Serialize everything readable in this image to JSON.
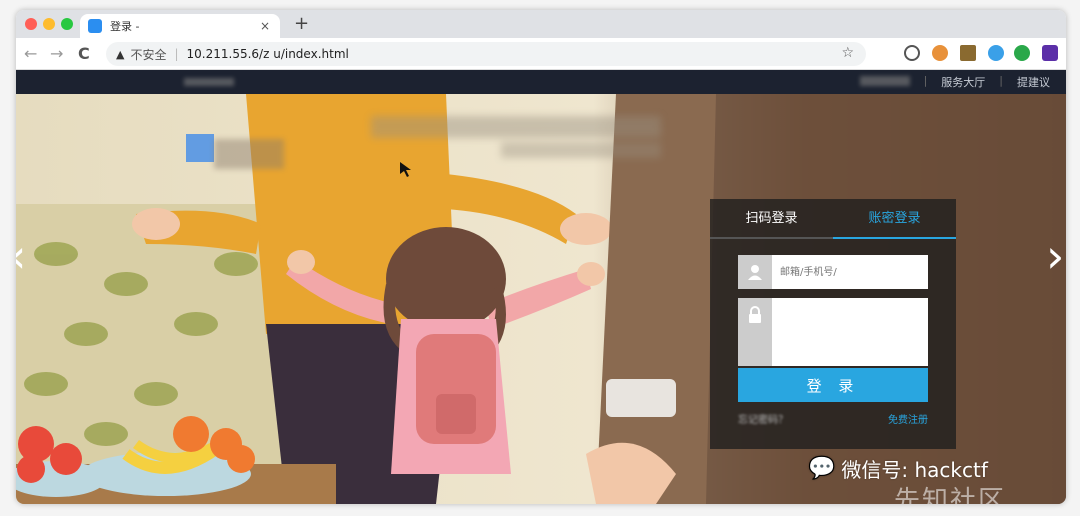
{
  "browser": {
    "tab_title": "登录 - ",
    "tab_close": "×",
    "new_tab": "+",
    "back": "←",
    "forward": "→",
    "reload": "C",
    "security_icon": "warning-triangle-icon",
    "security_label": "不安全",
    "url": "10.211.55.6/z          u/index.html",
    "bookmark": "☆"
  },
  "site_nav": {
    "links": [
      "服务大厅",
      "提建议"
    ]
  },
  "hero": {
    "prev_arrow": "‹",
    "next_arrow": "›"
  },
  "login": {
    "tab_qr": "扫码登录",
    "tab_account": "账密登录",
    "username_placeholder": "邮箱/手机号/",
    "password_placeholder": "",
    "submit": "登 录",
    "forgot": "忘记密码？",
    "register": "免费注册"
  },
  "watermark": {
    "text": "微信号: hackctf",
    "logo": "先知社区"
  },
  "colors": {
    "accent": "#29a6e0",
    "nav_bg": "#1c2230",
    "panel_bg": "#1e1e1e"
  }
}
